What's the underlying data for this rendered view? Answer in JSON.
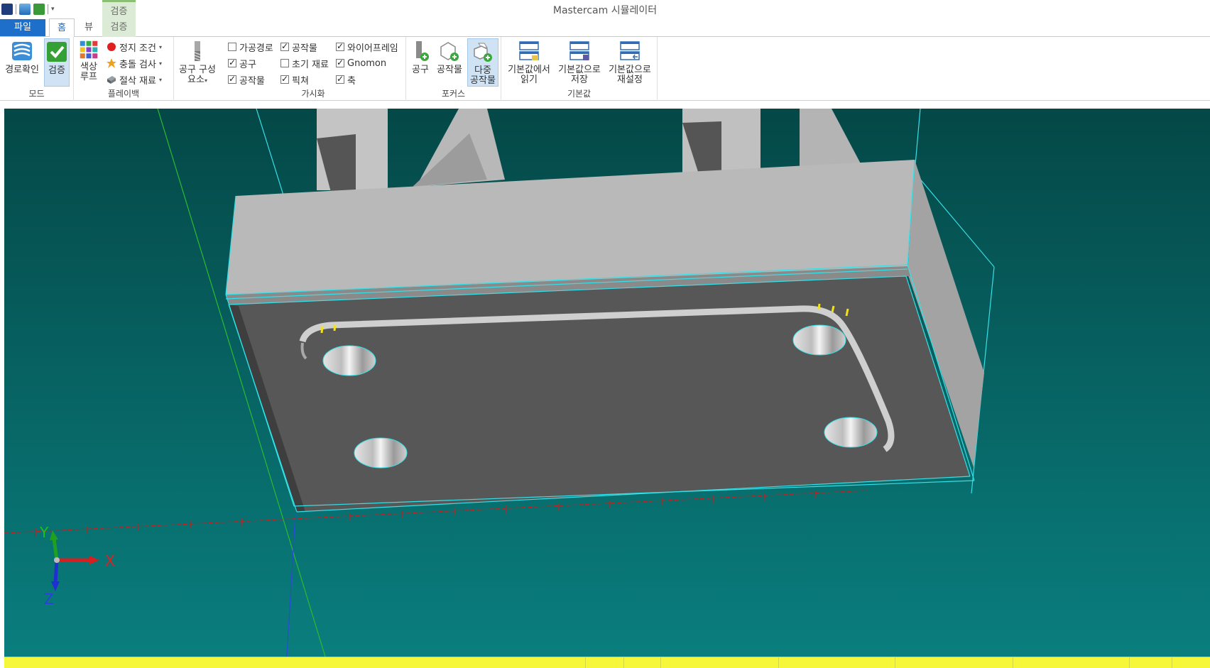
{
  "app": {
    "title": "Mastercam 시뮬레이터"
  },
  "context_tab": {
    "title": "검증"
  },
  "tabs": {
    "file": "파일",
    "home": "홈",
    "view": "뷰",
    "verify": "검증"
  },
  "ribbon": {
    "mode": {
      "label": "모드",
      "path_check": "경로확인",
      "verify": "검증"
    },
    "playback": {
      "label": "플레이백",
      "color_loop_line1": "색상",
      "color_loop_line2": "루프",
      "stop_conditions": "정지 조건",
      "collision_check": "충돌 검사",
      "cut_stock": "절삭 재료"
    },
    "tool_components": {
      "line1": "공구 구성",
      "line2": "요소"
    },
    "visualize": {
      "label": "가시화",
      "toolpath": "가공경로",
      "tool": "공구",
      "workpiece_a": "공작물",
      "workpiece_b": "공작물",
      "initial_stock": "초기 재료",
      "fixture": "픽쳐",
      "wireframe": "와이어프레임",
      "gnomon": "Gnomon",
      "axis": "축"
    },
    "focus": {
      "label": "포커스",
      "tool": "공구",
      "workpiece": "공작물",
      "multi_line1": "다중",
      "multi_line2": "공작물"
    },
    "defaults": {
      "label": "기본값",
      "read_line1": "기본값에서",
      "read_line2": "읽기",
      "save_line1": "기본값으로",
      "save_line2": "저장",
      "reset_line1": "기본값으로",
      "reset_line2": "재설정"
    }
  },
  "gnomon_labels": {
    "x": "X",
    "y": "Y",
    "z": "Z"
  },
  "colors": {
    "accent": "#1e6fc9",
    "context": "#dcebd5",
    "viewport_top": "#044c4a",
    "viewport_bottom": "#0a7c7c",
    "wireframe": "#36e0e8",
    "stock_top": "#5a5a5a",
    "fixture": "#b8b8b8",
    "statusbar": "#f6f63a"
  }
}
